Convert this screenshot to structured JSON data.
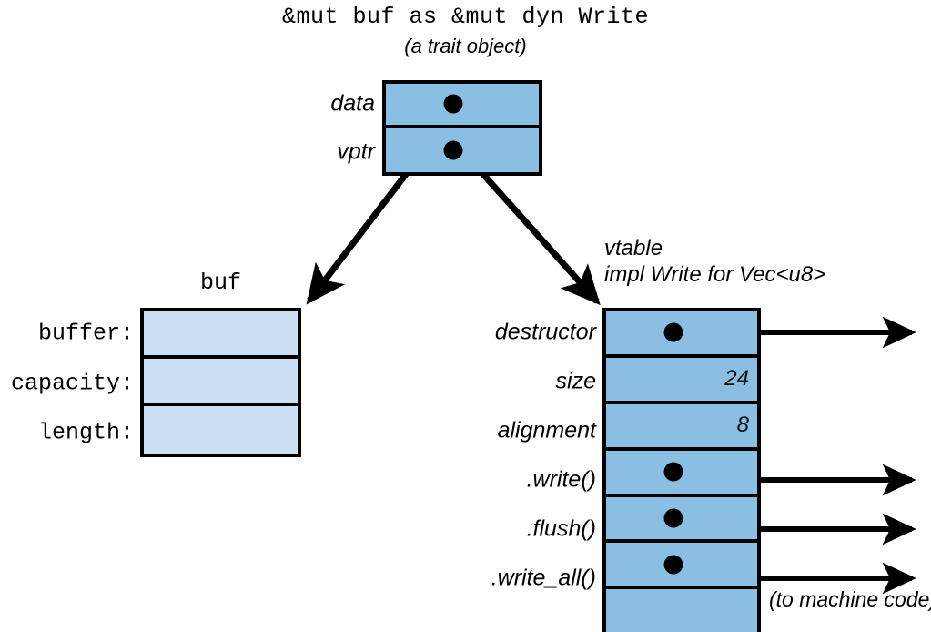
{
  "title": {
    "expression": "&mut buf as &mut dyn Write",
    "subtitle": "(a trait object)"
  },
  "trait_object": {
    "rows": [
      {
        "label": "data",
        "kind": "pointer"
      },
      {
        "label": "vptr",
        "kind": "pointer"
      }
    ],
    "fill_color": "#8abee3"
  },
  "buf": {
    "caption": "buf",
    "rows": [
      {
        "label": "buffer:",
        "value": ""
      },
      {
        "label": "capacity:",
        "value": ""
      },
      {
        "label": "length:",
        "value": ""
      }
    ],
    "fill_color": "#cbe0f2"
  },
  "vtable": {
    "caption_line1": "vtable",
    "caption_line2": "impl Write for Vec<u8>",
    "rows": [
      {
        "label": "destructor",
        "value": "",
        "kind": "pointer"
      },
      {
        "label": "size",
        "value": "24",
        "kind": "value"
      },
      {
        "label": "alignment",
        "value": "8",
        "kind": "value"
      },
      {
        "label": ".write()",
        "value": "",
        "kind": "pointer"
      },
      {
        "label": ".flush()",
        "value": "",
        "kind": "pointer"
      },
      {
        "label": ".write_all()",
        "value": "",
        "kind": "pointer"
      },
      {
        "label": "",
        "value": "",
        "kind": "empty"
      }
    ],
    "fill_color": "#8abee3"
  },
  "annotations": {
    "machine_code": "(to machine code)"
  },
  "colors": {
    "stroke": "#000000",
    "trait_fill": "#8abee3",
    "buf_fill": "#cbe0f2",
    "background": "#ffffff"
  }
}
